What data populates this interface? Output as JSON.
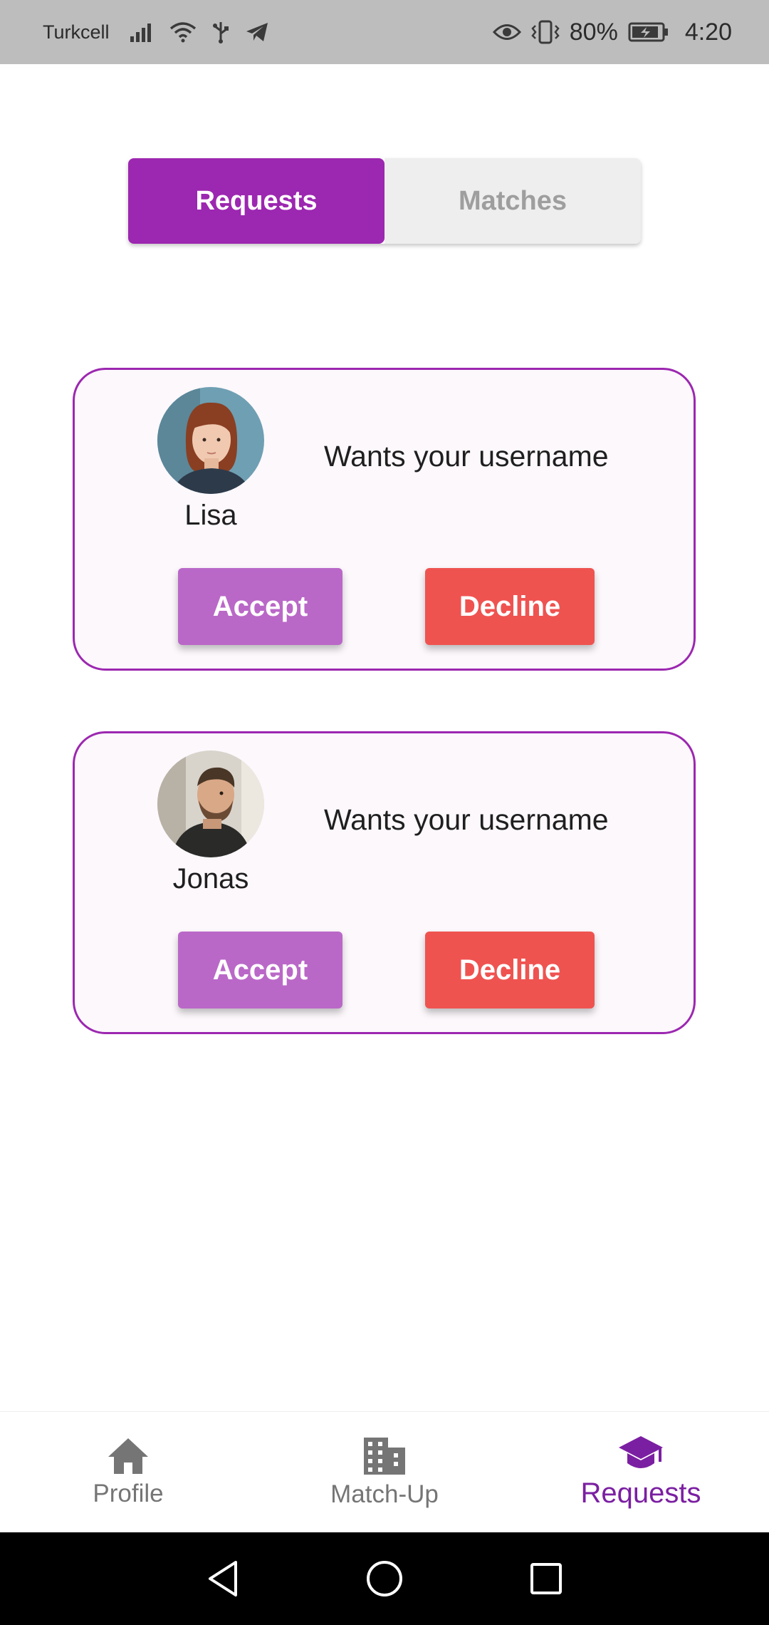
{
  "status_bar": {
    "carrier": "Turkcell",
    "battery": "80%",
    "time": "4:20",
    "icons": [
      "signal-icon",
      "wifi-icon",
      "usb-icon",
      "telegram-icon",
      "eye-icon",
      "vibrate-icon",
      "battery-icon"
    ]
  },
  "tabs": [
    {
      "label": "Requests",
      "active": true
    },
    {
      "label": "Matches",
      "active": false
    }
  ],
  "requests": [
    {
      "name": "Lisa",
      "message": "Wants your username",
      "accept_label": "Accept",
      "decline_label": "Decline",
      "avatar_icon": "avatar-lisa"
    },
    {
      "name": "Jonas",
      "message": "Wants your username",
      "accept_label": "Accept",
      "decline_label": "Decline",
      "avatar_icon": "avatar-jonas"
    }
  ],
  "bottom_nav": [
    {
      "label": "Profile",
      "icon": "home-icon",
      "active": false
    },
    {
      "label": "Match-Up",
      "icon": "building-icon",
      "active": false
    },
    {
      "label": "Requests",
      "icon": "graduation-cap-icon",
      "active": true
    }
  ],
  "colors": {
    "primary": "#9c27b0",
    "accept": "#ba68c8",
    "decline": "#ef5350",
    "active_nav": "#7b1fa2",
    "inactive_tab_text": "#9e9e9e"
  }
}
